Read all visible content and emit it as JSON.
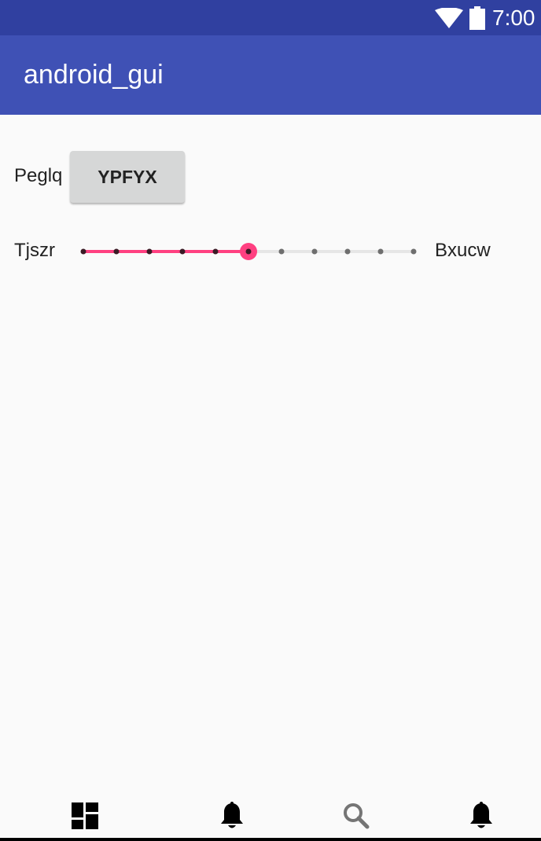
{
  "status_bar": {
    "time": "7:00",
    "wifi_icon": "wifi-icon",
    "battery_icon": "battery-icon"
  },
  "app_bar": {
    "title": "android_gui"
  },
  "row1": {
    "label": "Peglq",
    "button_label": "YPFYX"
  },
  "row2": {
    "left_label": "Tjszr",
    "right_label": "Bxucw",
    "slider": {
      "min": 0,
      "max": 10,
      "value": 5,
      "step": 1,
      "accent_color": "#ff4081"
    }
  },
  "bottom_nav": {
    "items": [
      {
        "icon": "dashboard-icon"
      },
      {
        "icon": "bell-icon"
      },
      {
        "icon": "search-icon"
      },
      {
        "icon": "bell-icon"
      }
    ]
  },
  "colors": {
    "status_bar": "#3040a0",
    "app_bar": "#3f51b5",
    "background": "#fafafa",
    "accent": "#ff4081"
  }
}
